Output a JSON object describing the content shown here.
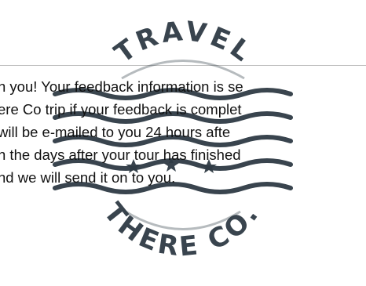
{
  "stamp": {
    "top_text": "TRAVEL",
    "bottom_text": "THERE CO.",
    "color": "#2f3b45"
  },
  "content": {
    "lines": [
      "n you! Your feedback information is se",
      "ere Co trip if your feedback is complet",
      "will be e-mailed to you 24 hours afte",
      "n the days after your tour has finished",
      "nd we will send it on to you."
    ],
    "text_color": "#111111"
  },
  "divider_color": "#bdbdbd"
}
